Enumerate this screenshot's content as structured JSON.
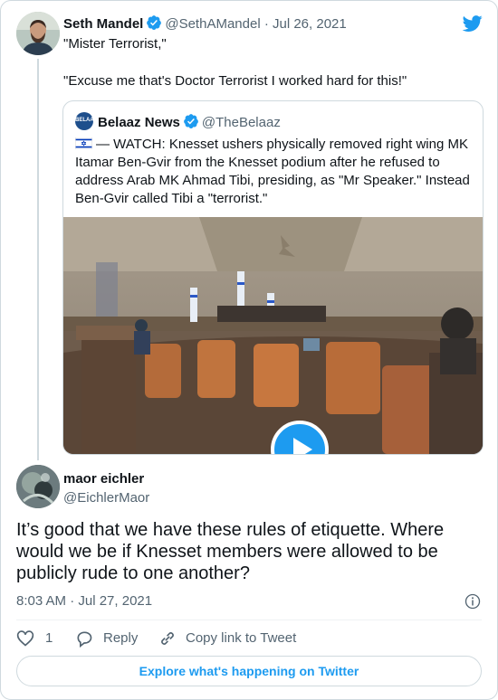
{
  "tweet": {
    "author_name": "Seth Mandel",
    "author_handle": "@SethAMandel",
    "date": "· Jul 26, 2021",
    "line1": "\"Mister Terrorist,\"",
    "line2": "\"Excuse me that's Doctor Terrorist I worked hard for this!\"",
    "icons": [
      "avatar",
      "verified-badge",
      "twitter-bird-logo"
    ]
  },
  "quoted": {
    "author_name": "Belaaz News",
    "author_handle": "@TheBelaaz",
    "avatar_text": "BELAAZ",
    "text": "— WATCH: Knesset ushers physically removed right wing MK Itamar Ben-Gvir from the Knesset podium after he refused to address Arab MK Ahmad Tibi, presiding, as \"Mr Speaker.\" Instead Ben-Gvir called Tibi a \"terrorist.\"",
    "flag_icon": "israel-flag-icon",
    "media": "video-thumbnail-knesset-plenary",
    "play_icon": "play-icon"
  },
  "reply": {
    "author_name": "maor eichler",
    "author_handle": "@EichlerMaor",
    "text": "It’s good that we have these rules of etiquette. Where would we be if Knesset members were allowed to be publicly rude to one another?",
    "timestamp": "8:03 AM · Jul 27, 2021"
  },
  "actions": {
    "likes": "1",
    "reply_label": "Reply",
    "copy_label": "Copy link to Tweet"
  },
  "footer": {
    "explore_label": "Explore what's happening on Twitter"
  },
  "colors": {
    "accent": "#1d9bf0",
    "text": "#0f1419",
    "muted": "#536471",
    "border": "#cfd9de"
  }
}
